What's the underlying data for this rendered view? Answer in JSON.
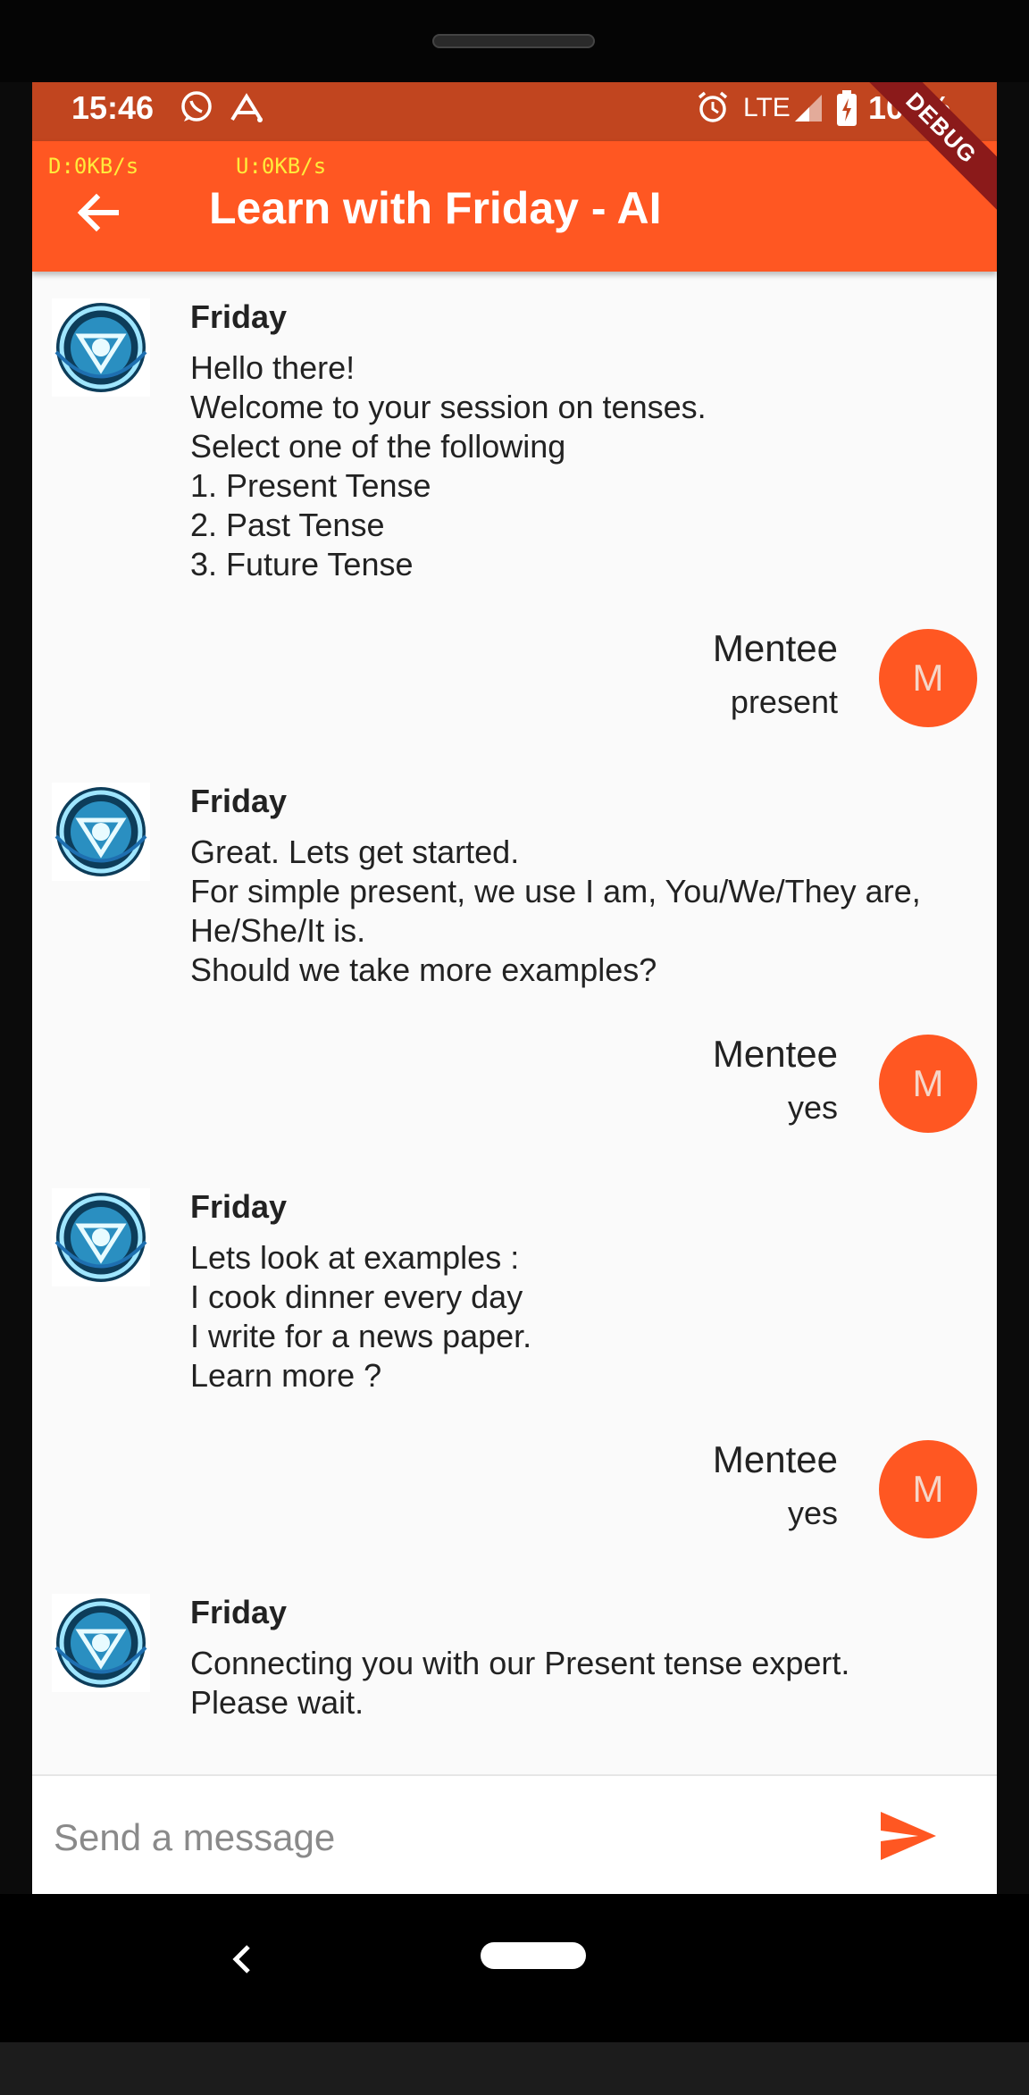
{
  "status_bar": {
    "time": "15:46",
    "network": "LTE",
    "battery": "100%"
  },
  "net_speed": {
    "down": "D:0KB/s",
    "up": "U:0KB/s"
  },
  "app_bar": {
    "title": "Learn with Friday - AI",
    "debug_label": "DEBUG"
  },
  "messages": [
    {
      "sender": "Friday",
      "role": "bot",
      "text": "Hello there!\nWelcome to your session on tenses.\nSelect one of the following\n1. Present Tense\n2. Past Tense\n3. Future Tense"
    },
    {
      "sender": "Mentee",
      "role": "user",
      "text": "present",
      "avatar_letter": "M"
    },
    {
      "sender": "Friday",
      "role": "bot",
      "text": "Great. Lets get started.\nFor simple present, we use I am, You/We/They are,\nHe/She/It is.\nShould we take more examples?"
    },
    {
      "sender": "Mentee",
      "role": "user",
      "text": "yes",
      "avatar_letter": "M"
    },
    {
      "sender": "Friday",
      "role": "bot",
      "text": "Lets look at examples :\nI cook dinner every day\nI write for a news paper.\nLearn more ?"
    },
    {
      "sender": "Mentee",
      "role": "user",
      "text": "yes",
      "avatar_letter": "M"
    },
    {
      "sender": "Friday",
      "role": "bot",
      "text": "Connecting you with our Present tense expert.\nPlease wait."
    }
  ],
  "composer": {
    "placeholder": "Send a message"
  },
  "colors": {
    "accent": "#ff5722",
    "status_bar": "#c1451f",
    "background": "#fafafa"
  },
  "icons": {
    "back": "arrow-left-icon",
    "send": "send-icon",
    "bot_avatar": "arc-reactor-icon"
  }
}
